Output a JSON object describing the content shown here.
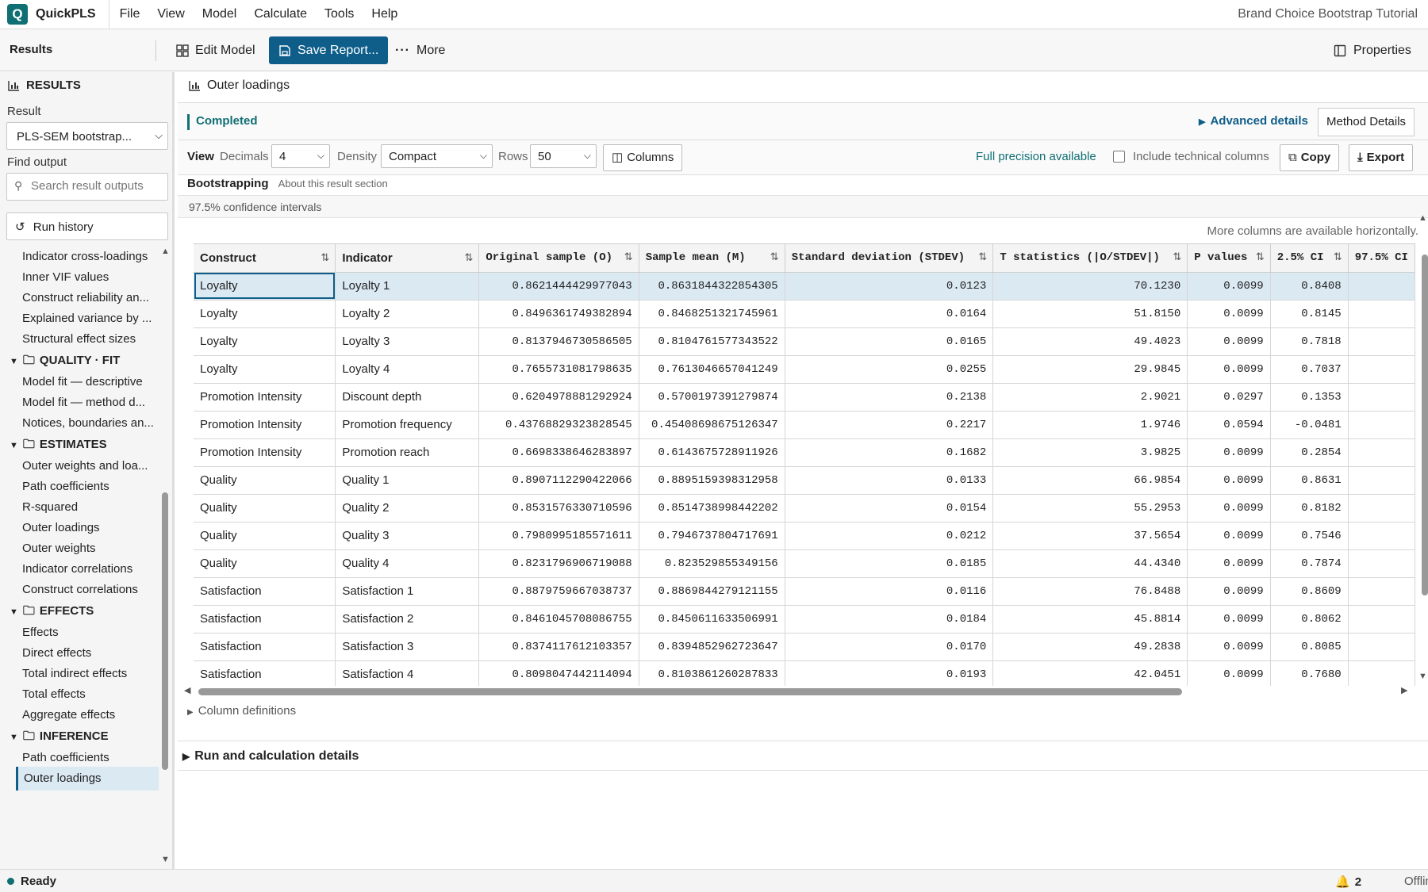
{
  "app": {
    "name": "QuickPLS",
    "logo_letter": "Q",
    "document_title": "Brand Choice Bootstrap Tutorial"
  },
  "menu": [
    "File",
    "View",
    "Model",
    "Calculate",
    "Tools",
    "Help"
  ],
  "toolbar": {
    "section_title": "Results",
    "edit_model": "Edit Model",
    "save_report": "Save Report...",
    "more": "More",
    "properties": "Properties"
  },
  "sidebar": {
    "header": "RESULTS",
    "result_label": "Result",
    "result_value": "PLS-SEM bootstrap...",
    "find_label": "Find output",
    "search_placeholder": "Search result outputs",
    "run_history": "Run history",
    "groups": [
      {
        "title": null,
        "items": [
          "Indicator cross-loadings",
          "Inner VIF values",
          "Construct reliability an...",
          "Explained variance by ...",
          "Structural effect sizes"
        ]
      },
      {
        "title": "QUALITY · FIT",
        "items": [
          "Model fit — descriptive",
          "Model fit — method d...",
          "Notices, boundaries an..."
        ]
      },
      {
        "title": "ESTIMATES",
        "items": [
          "Outer weights and loa...",
          "Path coefficients",
          "R-squared",
          "Outer loadings",
          "Outer weights",
          "Indicator correlations",
          "Construct correlations"
        ]
      },
      {
        "title": "EFFECTS",
        "items": [
          "Effects",
          "Direct effects",
          "Total indirect effects",
          "Total effects",
          "Aggregate effects"
        ]
      },
      {
        "title": "INFERENCE",
        "items": [
          "Path coefficients",
          "Outer loadings"
        ]
      }
    ],
    "active_item": "Outer loadings"
  },
  "panel": {
    "title": "Outer loadings",
    "status": "Completed",
    "advanced_details": "Advanced details",
    "method_details": "Method Details",
    "view_label": "View",
    "decimals_label": "Decimals",
    "decimals_value": "4",
    "density_label": "Density",
    "density_value": "Compact",
    "rows_label": "Rows",
    "rows_value": "50",
    "columns_btn": "Columns",
    "full_precision": "Full precision available",
    "include_technical": "Include technical columns",
    "copy": "Copy",
    "export": "Export",
    "section_title": "Bootstrapping",
    "section_about": "About this result section",
    "ci_note": "97.5% confidence intervals",
    "more_columns_note": "More columns are available horizontally.",
    "column_definitions": "Column definitions",
    "run_details": "Run and calculation details"
  },
  "table": {
    "columns": [
      "Construct",
      "Indicator",
      "Original sample (O)",
      "Sample mean (M)",
      "Standard deviation (STDEV)",
      "T statistics (|O/STDEV|)",
      "P values",
      "2.5% CI",
      "97.5% CI"
    ],
    "rows": [
      [
        "Loyalty",
        "Loyalty 1",
        "0.8621444429977043",
        "0.8631844322854305",
        "0.0123",
        "70.1230",
        "0.0099",
        "0.8408",
        ""
      ],
      [
        "Loyalty",
        "Loyalty 2",
        "0.8496361749382894",
        "0.8468251321745961",
        "0.0164",
        "51.8150",
        "0.0099",
        "0.8145",
        ""
      ],
      [
        "Loyalty",
        "Loyalty 3",
        "0.8137946730586505",
        "0.8104761577343522",
        "0.0165",
        "49.4023",
        "0.0099",
        "0.7818",
        ""
      ],
      [
        "Loyalty",
        "Loyalty 4",
        "0.7655731081798635",
        "0.761304665704l249",
        "0.0255",
        "29.9845",
        "0.0099",
        "0.7037",
        ""
      ],
      [
        "Promotion Intensity",
        "Discount depth",
        "0.6204978881292924",
        "0.5700197391279874",
        "0.2138",
        "2.9021",
        "0.0297",
        "0.1353",
        ""
      ],
      [
        "Promotion Intensity",
        "Promotion frequency",
        "0.43768829323828545",
        "0.45408698675126347",
        "0.2217",
        "1.9746",
        "0.0594",
        "-0.0481",
        ""
      ],
      [
        "Promotion Intensity",
        "Promotion reach",
        "0.6698338646283897",
        "0.6143675728911926",
        "0.1682",
        "3.9825",
        "0.0099",
        "0.2854",
        ""
      ],
      [
        "Quality",
        "Quality 1",
        "0.8907112290422066",
        "0.8895159398312958",
        "0.0133",
        "66.9854",
        "0.0099",
        "0.8631",
        ""
      ],
      [
        "Quality",
        "Quality 2",
        "0.8531576330710596",
        "0.8514738998442202",
        "0.0154",
        "55.2953",
        "0.0099",
        "0.8182",
        ""
      ],
      [
        "Quality",
        "Quality 3",
        "0.7980995185571611",
        "0.7946737804717691",
        "0.0212",
        "37.5654",
        "0.0099",
        "0.7546",
        ""
      ],
      [
        "Quality",
        "Quality 4",
        "0.8231796906719088",
        "0.823529855349156",
        "0.0185",
        "44.4340",
        "0.0099",
        "0.7874",
        ""
      ],
      [
        "Satisfaction",
        "Satisfaction 1",
        "0.8879759667038737",
        "0.8869844279121155",
        "0.0116",
        "76.8488",
        "0.0099",
        "0.8609",
        ""
      ],
      [
        "Satisfaction",
        "Satisfaction 2",
        "0.8461045708086755",
        "0.8450611633506991",
        "0.0184",
        "45.8814",
        "0.0099",
        "0.8062",
        ""
      ],
      [
        "Satisfaction",
        "Satisfaction 3",
        "0.8374117612103357",
        "0.8394852962723647",
        "0.0170",
        "49.2838",
        "0.0099",
        "0.8085",
        ""
      ],
      [
        "Satisfaction",
        "Satisfaction 4",
        "0.8098047442114094",
        "0.8103861260287833",
        "0.0193",
        "42.0451",
        "0.0099",
        "0.7680",
        ""
      ]
    ]
  },
  "statusbar": {
    "ready": "Ready",
    "notifications": "2",
    "offline": "Offline"
  }
}
